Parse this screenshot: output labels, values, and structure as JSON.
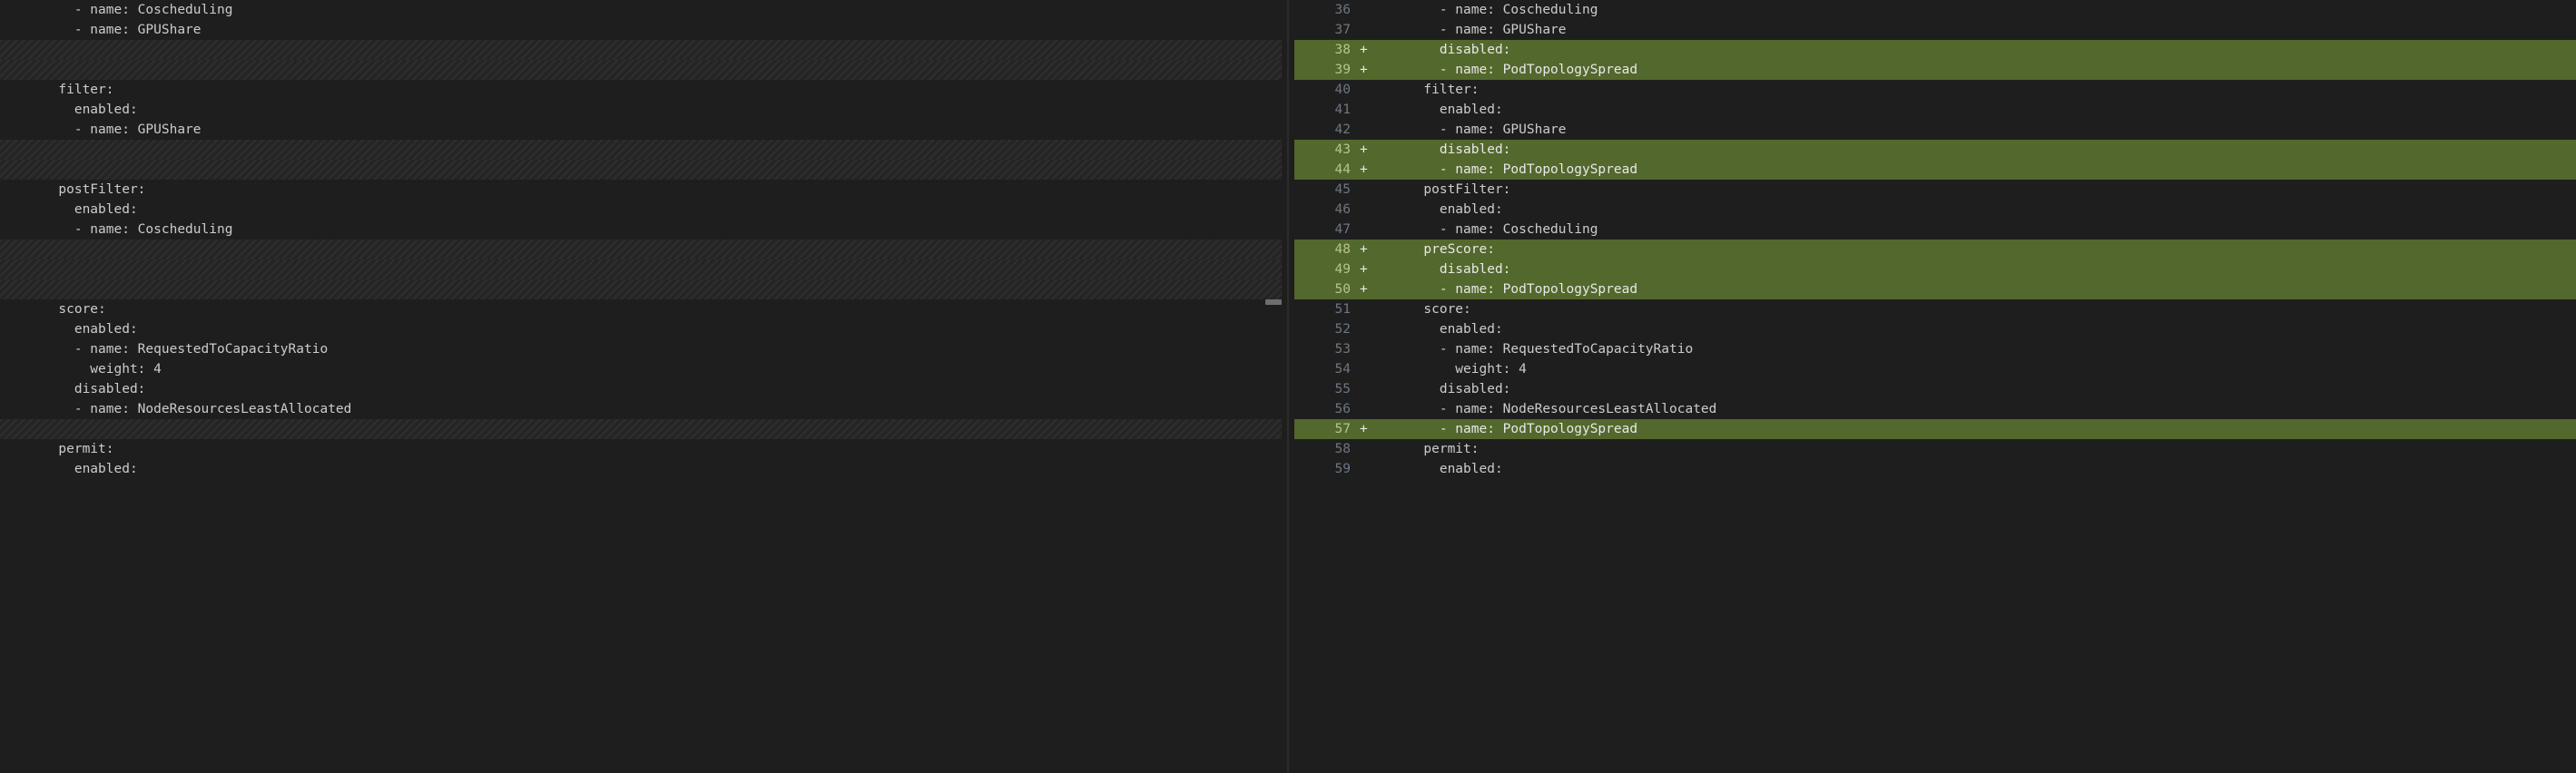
{
  "left": {
    "lines": [
      {
        "kind": "code",
        "text": "        - name: Coscheduling"
      },
      {
        "kind": "code",
        "text": "        - name: GPUShare"
      },
      {
        "kind": "hatch",
        "text": ""
      },
      {
        "kind": "hatch",
        "text": ""
      },
      {
        "kind": "code",
        "text": "      filter:"
      },
      {
        "kind": "code",
        "text": "        enabled:"
      },
      {
        "kind": "code",
        "text": "        - name: GPUShare"
      },
      {
        "kind": "hatch",
        "text": ""
      },
      {
        "kind": "hatch",
        "text": ""
      },
      {
        "kind": "code",
        "text": "      postFilter:"
      },
      {
        "kind": "code",
        "text": "        enabled:"
      },
      {
        "kind": "code",
        "text": "        - name: Coscheduling"
      },
      {
        "kind": "hatch",
        "text": ""
      },
      {
        "kind": "hatch",
        "text": ""
      },
      {
        "kind": "hatch",
        "text": ""
      },
      {
        "kind": "code",
        "text": "      score:"
      },
      {
        "kind": "code",
        "text": "        enabled:"
      },
      {
        "kind": "code",
        "text": "        - name: RequestedToCapacityRatio"
      },
      {
        "kind": "code",
        "text": "          weight: 4"
      },
      {
        "kind": "code",
        "text": "        disabled:"
      },
      {
        "kind": "code",
        "text": "        - name: NodeResourcesLeastAllocated"
      },
      {
        "kind": "hatch",
        "text": ""
      },
      {
        "kind": "code",
        "text": "      permit:"
      },
      {
        "kind": "code",
        "text": "        enabled:"
      }
    ]
  },
  "right": {
    "lines": [
      {
        "num": "36",
        "sign": " ",
        "kind": "code",
        "text": "        - name: Coscheduling"
      },
      {
        "num": "37",
        "sign": " ",
        "kind": "code",
        "text": "        - name: GPUShare"
      },
      {
        "num": "38",
        "sign": "+",
        "kind": "added",
        "text": "        disabled:"
      },
      {
        "num": "39",
        "sign": "+",
        "kind": "added",
        "text": "        - name: PodTopologySpread"
      },
      {
        "num": "40",
        "sign": " ",
        "kind": "code",
        "text": "      filter:"
      },
      {
        "num": "41",
        "sign": " ",
        "kind": "code",
        "text": "        enabled:"
      },
      {
        "num": "42",
        "sign": " ",
        "kind": "code",
        "text": "        - name: GPUShare"
      },
      {
        "num": "43",
        "sign": "+",
        "kind": "added",
        "text": "        disabled:"
      },
      {
        "num": "44",
        "sign": "+",
        "kind": "added",
        "text": "        - name: PodTopologySpread"
      },
      {
        "num": "45",
        "sign": " ",
        "kind": "code",
        "text": "      postFilter:"
      },
      {
        "num": "46",
        "sign": " ",
        "kind": "code",
        "text": "        enabled:"
      },
      {
        "num": "47",
        "sign": " ",
        "kind": "code",
        "text": "        - name: Coscheduling"
      },
      {
        "num": "48",
        "sign": "+",
        "kind": "added",
        "text": "      preScore:"
      },
      {
        "num": "49",
        "sign": "+",
        "kind": "added",
        "text": "        disabled:"
      },
      {
        "num": "50",
        "sign": "+",
        "kind": "added",
        "text": "        - name: PodTopologySpread"
      },
      {
        "num": "51",
        "sign": " ",
        "kind": "code",
        "text": "      score:"
      },
      {
        "num": "52",
        "sign": " ",
        "kind": "code",
        "text": "        enabled:"
      },
      {
        "num": "53",
        "sign": " ",
        "kind": "code",
        "text": "        - name: RequestedToCapacityRatio"
      },
      {
        "num": "54",
        "sign": " ",
        "kind": "code",
        "text": "          weight: 4"
      },
      {
        "num": "55",
        "sign": " ",
        "kind": "code",
        "text": "        disabled:"
      },
      {
        "num": "56",
        "sign": " ",
        "kind": "code",
        "text": "        - name: NodeResourcesLeastAllocated"
      },
      {
        "num": "57",
        "sign": "+",
        "kind": "added",
        "text": "        - name: PodTopologySpread"
      },
      {
        "num": "58",
        "sign": " ",
        "kind": "code",
        "text": "      permit:"
      },
      {
        "num": "59",
        "sign": " ",
        "kind": "code",
        "text": "        enabled:"
      }
    ]
  }
}
